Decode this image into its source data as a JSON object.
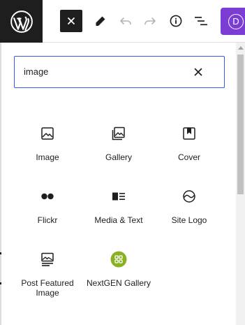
{
  "toolbar": {
    "logo_icon": "wordpress-logo",
    "close_icon": "close-icon",
    "edit_icon": "pencil-icon",
    "undo_icon": "undo-icon",
    "redo_icon": "redo-icon",
    "info_icon": "info-icon",
    "outline_icon": "list-view-icon",
    "avatar_letter": "D",
    "avatar_color": "#7b3dd6"
  },
  "inserter": {
    "search_value": "image",
    "clear_icon": "close-icon",
    "accent_color": "#3858e9",
    "blocks": [
      {
        "label": "Image",
        "icon": "image-icon"
      },
      {
        "label": "Gallery",
        "icon": "gallery-icon"
      },
      {
        "label": "Cover",
        "icon": "cover-icon"
      },
      {
        "label": "Flickr",
        "icon": "flickr-icon"
      },
      {
        "label": "Media & Text",
        "icon": "media-text-icon"
      },
      {
        "label": "Site Logo",
        "icon": "site-logo-icon"
      },
      {
        "label": "Post Featured Image",
        "icon": "post-featured-image-icon"
      },
      {
        "label": "NextGEN Gallery",
        "icon": "nextgen-gallery-icon",
        "icon_color": "#8bb024"
      }
    ]
  }
}
